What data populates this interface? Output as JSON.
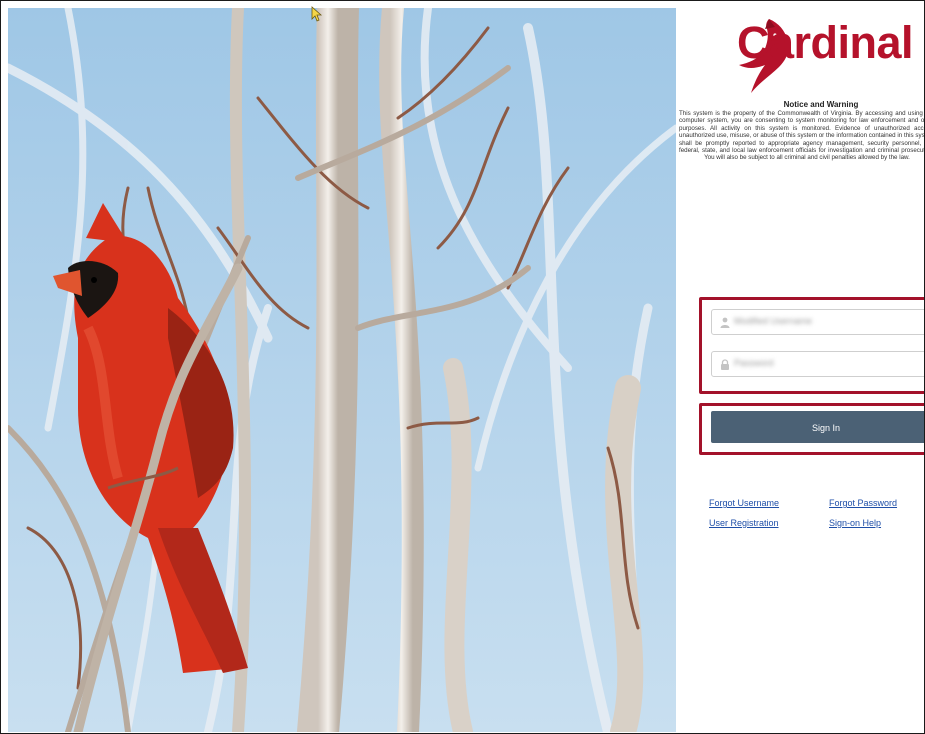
{
  "brand": {
    "name": "Cardinal",
    "color": "#b5122b"
  },
  "notice": {
    "title": "Notice and Warning",
    "body": "This system is the property of the Commonwealth of Virginia. By accessing and using this computer system, you are consenting to system monitoring for law enforcement and other purposes. All activity on this system is monitored. Evidence of unauthorized access, unauthorized use, misuse, or abuse of this system or the information contained in this system shall be promptly reported to appropriate agency management, security personnel, and federal, state, and local law enforcement officials for investigation and criminal prosecution. You will also be subject to all criminal and civil penalties allowed by the law."
  },
  "login": {
    "username_placeholder": "Modified Username",
    "password_placeholder": "Password",
    "signin_label": "Sign In"
  },
  "links": {
    "forgot_username": "Forgot Username",
    "forgot_password": "Forgot Password",
    "user_registration": "User Registration",
    "signon_help": "Sign-on Help"
  },
  "icons": [
    "user-icon",
    "lock-icon",
    "help-icon",
    "cardinal-logo-icon",
    "mouse-cursor-icon"
  ],
  "colors": {
    "button": "#4b6175",
    "highlight": "#a3122a",
    "link": "#1f4fa8",
    "sky": "#a9cde8"
  }
}
